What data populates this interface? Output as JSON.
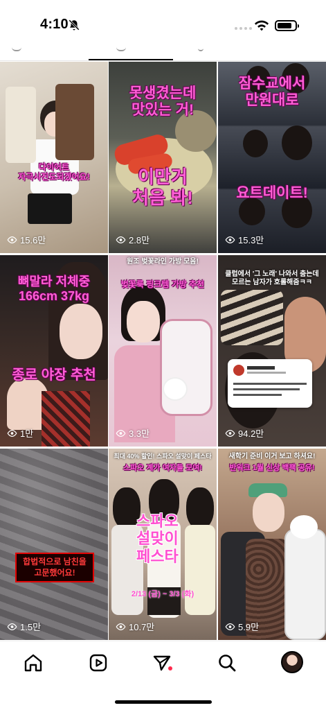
{
  "status_bar": {
    "time": "4:10"
  },
  "tiles": [
    {
      "views": "15.6만",
      "caption": "다이어트\n자극사진도되겠어요!",
      "colors": [
        "#d9d2c6",
        "#b8a58a"
      ]
    },
    {
      "views": "2.8만",
      "caption_top": "못생겼는데\n맛있는 거!",
      "caption_bottom": "이만거\n처음 봐!",
      "colors": [
        "#4b4e4a",
        "#c9c2a0"
      ]
    },
    {
      "views": "15.3만",
      "caption_top": "잠수교에서\n만원대로",
      "caption_bottom": "요트데이트!",
      "colors": [
        "#3a3f4a",
        "#1e2430"
      ]
    },
    {
      "views": "1만",
      "caption_top": "뼈말라 저체중\n166cm 37kg",
      "caption_bottom": "종로 야장 추천",
      "colors": [
        "#3a2b26",
        "#7a4438"
      ]
    },
    {
      "views": "3.3만",
      "caption_small": "원조 벚꽃라인 가방 모음!",
      "caption_pink": "벚꽃룩 핑크템 가방 추천",
      "colors": [
        "#e9c8d6",
        "#d9a3bb"
      ]
    },
    {
      "views": "94.2만",
      "caption_small": "클럽에서 '그 노래' 나와서 춤는데\n모르는 남자가 호롤해줌ㅋㅋ",
      "colors": [
        "#2a2523",
        "#5a4e48"
      ]
    },
    {
      "views": "1.5만",
      "caption_red": "합법적으로 남친을\n고문했어요!",
      "colors": [
        "#6f6c6e",
        "#4e4b4e"
      ]
    },
    {
      "views": "10.7만",
      "caption_small": "최대 40% 할인! 스파오 설맞이 페스타",
      "caption_pink": "스파오 계가 여자들 모여!",
      "caption_big": "스파오\n설맞이\n페스타",
      "caption_date": "2/13 (금) ~ 3/3 (화)",
      "colors": [
        "#cdb9a8",
        "#8a7565"
      ]
    },
    {
      "views": "5.9만",
      "caption_small": "새학기 준비 이거 보고 하셔요!",
      "caption_pink": "반워크 1월 신상 백팩 공유!",
      "colors": [
        "#b89a82",
        "#6d4a3c"
      ]
    }
  ],
  "nav": {
    "home": "home-icon",
    "reels": "reels-icon",
    "send": "send-icon",
    "search": "search-icon",
    "profile": "avatar"
  }
}
